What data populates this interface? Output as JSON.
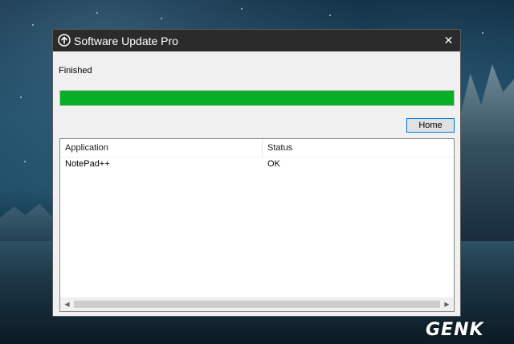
{
  "window": {
    "title": "Software Update Pro",
    "close_symbol": "✕",
    "app_icon": "update-icon"
  },
  "status": {
    "label": "Finished",
    "progress_percent": 100,
    "progress_color": "#06b025"
  },
  "buttons": {
    "home_label": "Home"
  },
  "table": {
    "columns": [
      "Application",
      "Status"
    ],
    "rows": [
      {
        "application": "NotePad++",
        "status": "OK"
      }
    ]
  },
  "scrollbar": {
    "left_arrow": "◀",
    "right_arrow": "▶"
  },
  "watermark": {
    "text": "GENK"
  }
}
